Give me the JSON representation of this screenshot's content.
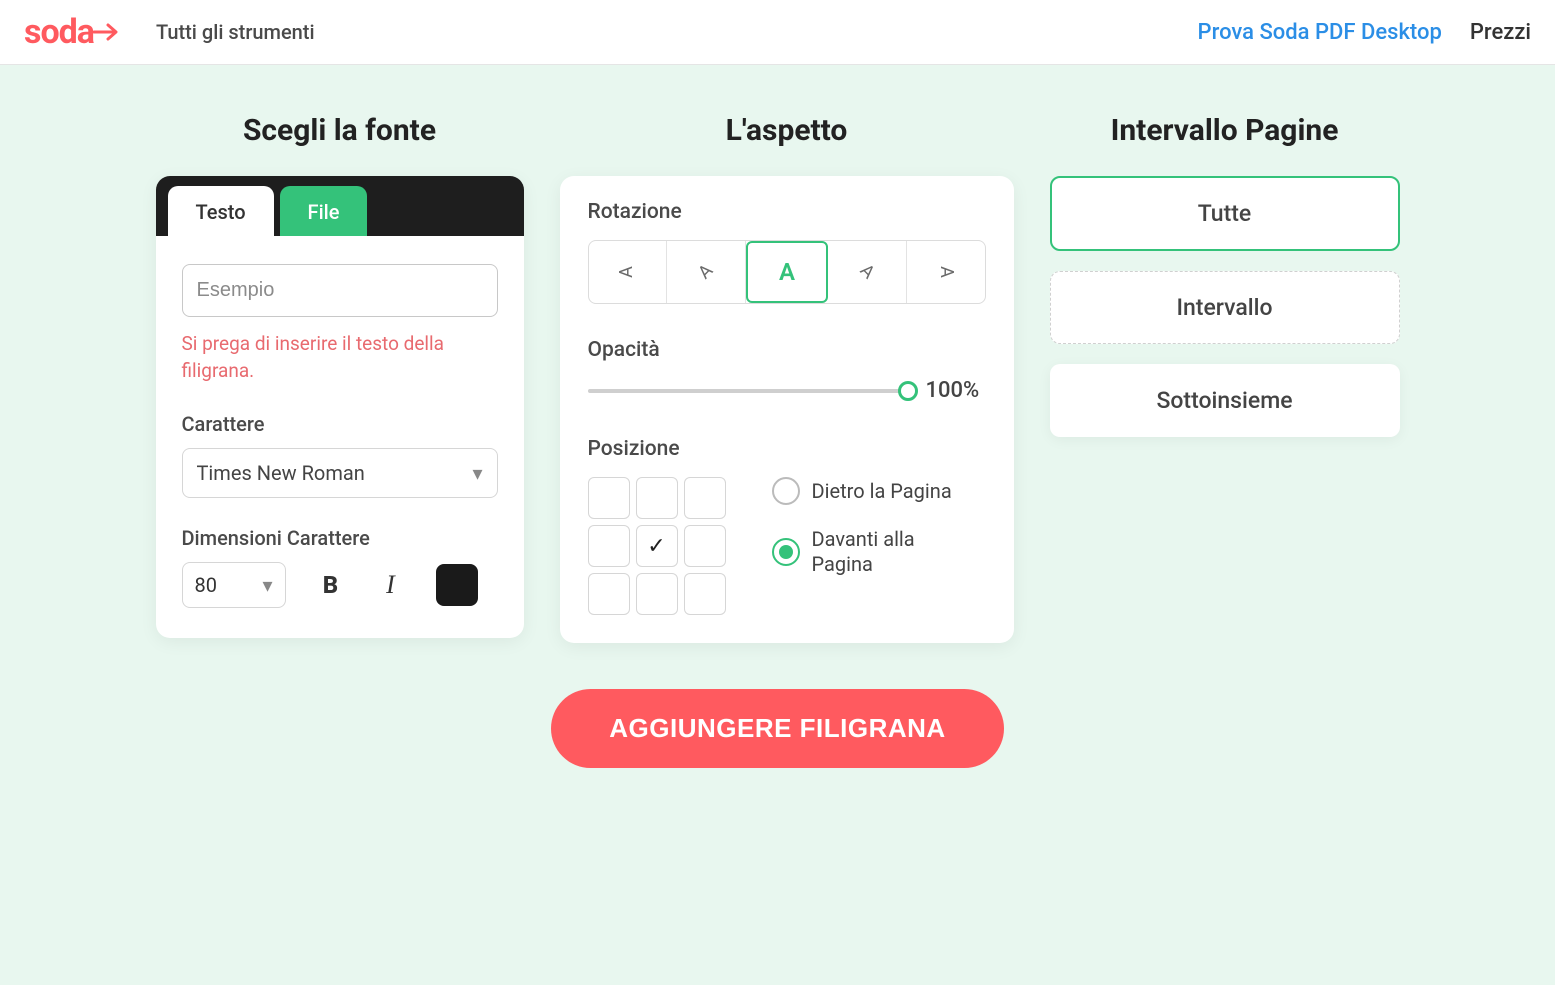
{
  "header": {
    "logo_text": "soda",
    "tools_label": "Tutti gli strumenti",
    "desktop_label": "Prova Soda PDF Desktop",
    "prices_label": "Prezzi"
  },
  "columns": {
    "source_title": "Scegli la fonte",
    "appearance_title": "L'aspetto",
    "range_title": "Intervallo Pagine"
  },
  "source": {
    "tabs": {
      "text": "Testo",
      "file": "File"
    },
    "placeholder": "Esempio",
    "error": "Si prega di inserire il testo della filigrana.",
    "font_label": "Carattere",
    "font_value": "Times New Roman",
    "size_label": "Dimensioni Carattere",
    "size_value": "80",
    "color": "#1a1a1a"
  },
  "appearance": {
    "rotation_label": "Rotazione",
    "rotation_active_index": 2,
    "opacity_label": "Opacità",
    "opacity_value": "100%",
    "position_label": "Posizione",
    "position_selected_index": 4,
    "radio_behind": "Dietro la Pagina",
    "radio_front": "Davanti alla Pagina",
    "radio_selected": "front"
  },
  "range": {
    "all": "Tutte",
    "interval": "Intervallo",
    "subset": "Sottoinsieme",
    "selected": "all"
  },
  "cta": {
    "label": "AGGIUNGERE FILIGRANA"
  },
  "chart_data": null
}
